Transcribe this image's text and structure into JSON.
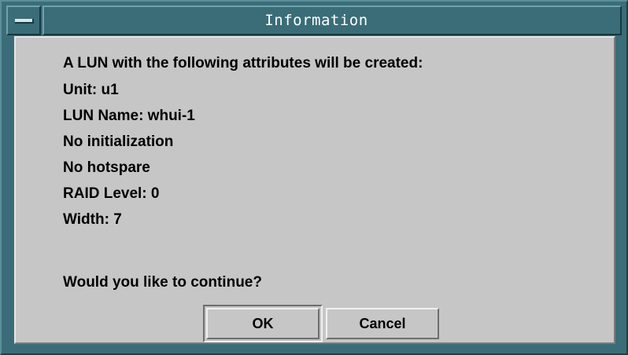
{
  "window": {
    "title": "Information"
  },
  "message": {
    "lines": [
      "A LUN with the following attributes will be created:",
      "Unit: u1",
      "LUN Name: whui-1",
      "No initialization",
      "No hotspare",
      "RAID Level: 0",
      "Width: 7"
    ],
    "question": "Would you like to continue?"
  },
  "buttons": {
    "ok_label": "OK",
    "cancel_label": "Cancel"
  },
  "colors": {
    "frame": "#3a6d78",
    "body": "#c6c6c6",
    "title_text": "#ffffff"
  },
  "icons": {
    "window_menu": "window-menu-icon"
  }
}
